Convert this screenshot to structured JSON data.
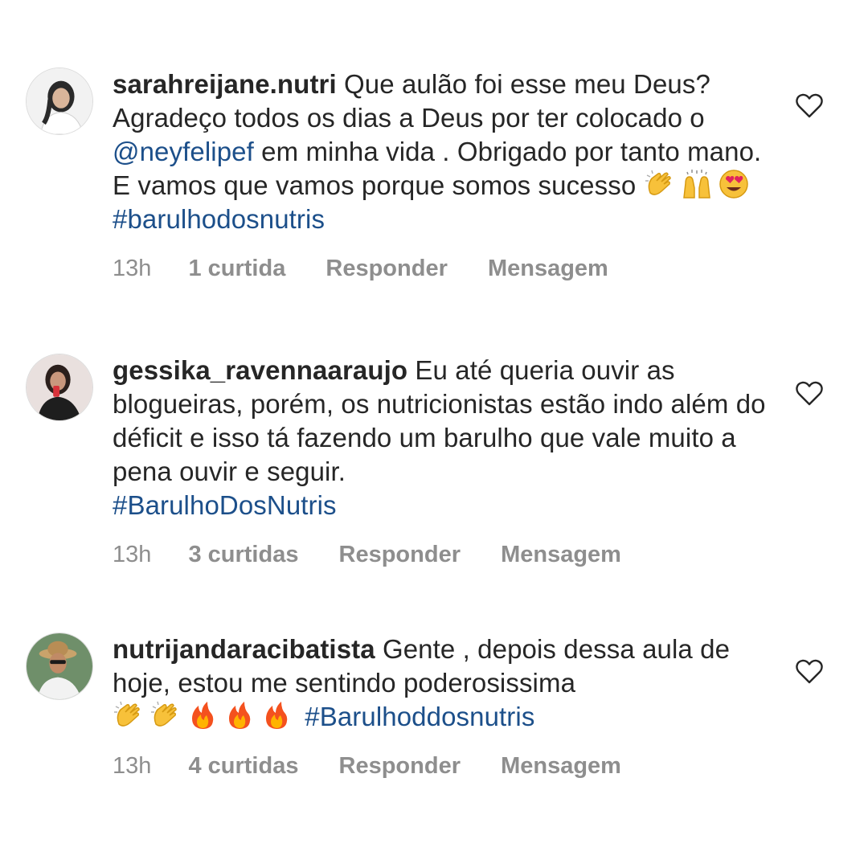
{
  "comments": [
    {
      "username": "sarahreijane.nutri",
      "text_1": " Que aulão foi esse meu Deus? Agradeço todos os dias a Deus por ter colocado o ",
      "mention": "@neyfelipef",
      "text_2": " em minha vida . Obrigado por tanto mano. E vamos que vamos porque somos sucesso ",
      "emojis": [
        "clapping-hands",
        "raising-hands",
        "heart-eyes"
      ],
      "hashtag": "#barulhodosnutris",
      "time": "13h",
      "likes": "1 curtida",
      "reply": "Responder",
      "message": "Mensagem"
    },
    {
      "username": "gessika_ravennaaraujo",
      "text_1": " Eu até queria ouvir as blogueiras, porém, os nutricionistas estão indo além do déficit e isso tá fazendo um barulho que vale muito a pena ouvir e seguir.",
      "hashtag": "#BarulhoDosNutris",
      "time": "13h",
      "likes": "3 curtidas",
      "reply": "Responder",
      "message": "Mensagem"
    },
    {
      "username": "nutrijandaracibatista",
      "text_1": " Gente , depois dessa aula de hoje, estou me sentindo poderosissima",
      "emojis": [
        "clapping-hands",
        "clapping-hands",
        "fire",
        "fire",
        "fire"
      ],
      "hashtag": "#Barulhoddosnutris",
      "time": "13h",
      "likes": "4 curtidas",
      "reply": "Responder",
      "message": "Mensagem"
    }
  ],
  "colors": {
    "text": "#262626",
    "link": "#1c4f8a",
    "meta": "#8e8e8e"
  }
}
